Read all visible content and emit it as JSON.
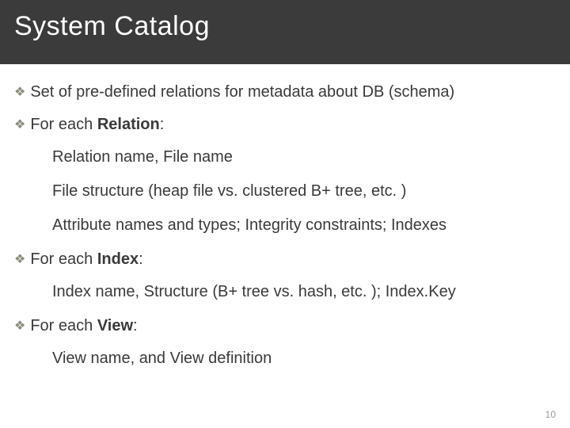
{
  "header": {
    "title": "System Catalog"
  },
  "bullets": {
    "b1": {
      "text": "Set of pre-defined relations for metadata about DB (schema)"
    },
    "b2": {
      "prefix": "For each ",
      "bold": "Relation",
      "suffix": ":"
    },
    "b2_subs": [
      "Relation name, File name",
      "File structure (heap file vs. clustered B+ tree, etc. )",
      "Attribute names and types; Integrity constraints; Indexes"
    ],
    "b3": {
      "prefix": "For each ",
      "bold": "Index",
      "suffix": ":"
    },
    "b3_subs": [
      "Index name, Structure (B+ tree vs. hash, etc. ); Index.Key"
    ],
    "b4": {
      "prefix": "For each ",
      "bold": "View",
      "suffix": ":"
    },
    "b4_subs": [
      "View name, and View definition"
    ]
  },
  "bullet_glyph": "❖",
  "page_number": "10"
}
